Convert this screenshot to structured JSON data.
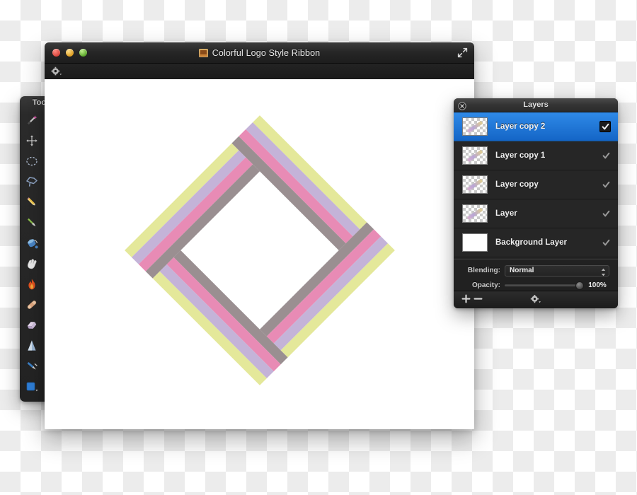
{
  "editor_window": {
    "title": "Colorful Logo Style Ribbon",
    "doc_icon": "document-icon",
    "traffic_lights": [
      {
        "name": "close-button",
        "color": "#d9453c"
      },
      {
        "name": "minimize-button",
        "color": "#dd9c20"
      },
      {
        "name": "maximize-button",
        "color": "#5aa52b"
      }
    ],
    "expand_icon": "expand-diagonal-icon",
    "toolbar_gear_icon": "gear-icon"
  },
  "artwork": {
    "name": "colorful-ribbon-logo",
    "stripe_colors": [
      "#e4e89a",
      "#c4b3d8",
      "#e88bb5",
      "#9a8f91"
    ],
    "center_fill": "#ffffff",
    "rotation_deg": 45
  },
  "tools_panel": {
    "title": "Tools",
    "tools": [
      {
        "name": "magic-wand-tool",
        "icon": "magic-wand-icon"
      },
      {
        "name": "arrow-select-tool",
        "icon": "arrow-cursor-icon"
      },
      {
        "name": "move-tool",
        "icon": "move-arrows-icon"
      },
      {
        "name": "rectangle-select-tool",
        "icon": "marquee-rect-icon"
      },
      {
        "name": "ellipse-select-tool",
        "icon": "marquee-ellipse-icon"
      },
      {
        "name": "lasso-tool",
        "icon": "lasso-icon"
      },
      {
        "name": "polygon-lasso-tool",
        "icon": "polygon-lasso-icon"
      },
      {
        "name": "crop-tool",
        "icon": "crop-icon"
      },
      {
        "name": "pencil-tool",
        "icon": "pencil-icon"
      },
      {
        "name": "eraser-tool",
        "icon": "eraser-icon"
      },
      {
        "name": "paintbrush-tool",
        "icon": "paintbrush-icon"
      },
      {
        "name": "pattern-tool",
        "icon": "checker-pattern-icon"
      },
      {
        "name": "paint-bucket-tool",
        "icon": "paint-bucket-icon"
      },
      {
        "name": "gradient-tool",
        "icon": "gradient-disc-icon"
      },
      {
        "name": "smudge-tool",
        "icon": "smudge-hand-icon"
      },
      {
        "name": "airbrush-tool",
        "icon": "airbrush-icon"
      },
      {
        "name": "burn-tool",
        "icon": "flame-icon"
      },
      {
        "name": "clone-stamp-tool",
        "icon": "stamp-icon"
      },
      {
        "name": "bandage-heal-tool",
        "icon": "bandage-icon"
      },
      {
        "name": "red-eye-tool",
        "icon": "eye-icon"
      },
      {
        "name": "block-eraser-tool",
        "icon": "block-eraser-icon"
      },
      {
        "name": "blur-tool",
        "icon": "water-drop-icon"
      },
      {
        "name": "sharpen-tool",
        "icon": "cone-icon"
      },
      {
        "name": "pen-tool",
        "icon": "pen-icon"
      },
      {
        "name": "calligraphy-pen-tool",
        "icon": "calligraphy-pen-icon"
      },
      {
        "name": "text-tool",
        "icon": "text-t-icon"
      },
      {
        "name": "shape-tool",
        "icon": "rounded-square-icon"
      },
      {
        "name": "zoom-tool",
        "icon": "magnifier-icon"
      },
      {
        "name": "eyedropper-tool",
        "icon": "eyedropper-icon"
      },
      {
        "name": "brush-tool",
        "icon": "brush-icon"
      }
    ]
  },
  "layers_panel": {
    "title": "Layers",
    "close_icon": "close-circle-icon",
    "layers": [
      {
        "name": "Layer copy 2",
        "selected": true,
        "visible": true,
        "thumb": "transparent"
      },
      {
        "name": "Layer copy 1",
        "selected": false,
        "visible": true,
        "thumb": "transparent"
      },
      {
        "name": "Layer copy",
        "selected": false,
        "visible": true,
        "thumb": "transparent"
      },
      {
        "name": "Layer",
        "selected": false,
        "visible": true,
        "thumb": "transparent"
      },
      {
        "name": "Background Layer",
        "selected": false,
        "visible": true,
        "thumb": "white"
      }
    ],
    "blending_label": "Blending:",
    "blending_value": "Normal",
    "blending_options": [
      "Normal"
    ],
    "opacity_label": "Opacity:",
    "opacity_value": "100%",
    "opacity_percent": 100,
    "footer": {
      "add_label": "+",
      "remove_label": "−",
      "gear_icon": "gear-icon"
    },
    "selection_color": "#2f8ae8"
  }
}
